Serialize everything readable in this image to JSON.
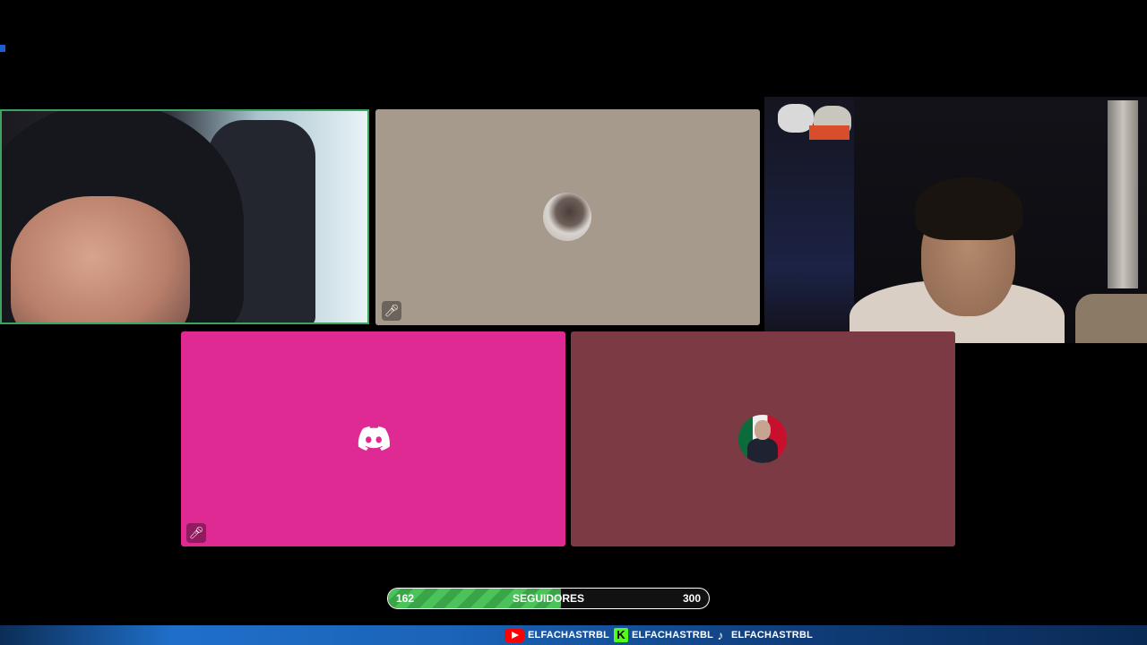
{
  "followers": {
    "current": "162",
    "label": "SEGUIDORES",
    "goal": "300",
    "progress_fraction": 0.54
  },
  "socials": [
    {
      "platform_icon": "youtube-icon",
      "handle": "ELFACHASTRBL"
    },
    {
      "platform_icon": "kick-icon",
      "handle": "ELFACHASTRBL"
    },
    {
      "platform_icon": "tiktok-icon",
      "handle": "ELFACHASTRBL"
    }
  ],
  "colors": {
    "background": "#000000",
    "speaking_border": "#3ba55d",
    "tile_gray": "#a69a8d",
    "tile_pink": "#df2a93",
    "tile_maroon": "#7b3a44",
    "progress_fill": "#4cc35a"
  },
  "tiles": [
    {
      "kind": "webcam",
      "speaking": true
    },
    {
      "kind": "avatar",
      "muted_icon": "mic-muted-icon"
    },
    {
      "kind": "webcam"
    },
    {
      "kind": "discord-default-avatar",
      "muted_icon": "mic-muted-icon"
    },
    {
      "kind": "avatar"
    }
  ]
}
